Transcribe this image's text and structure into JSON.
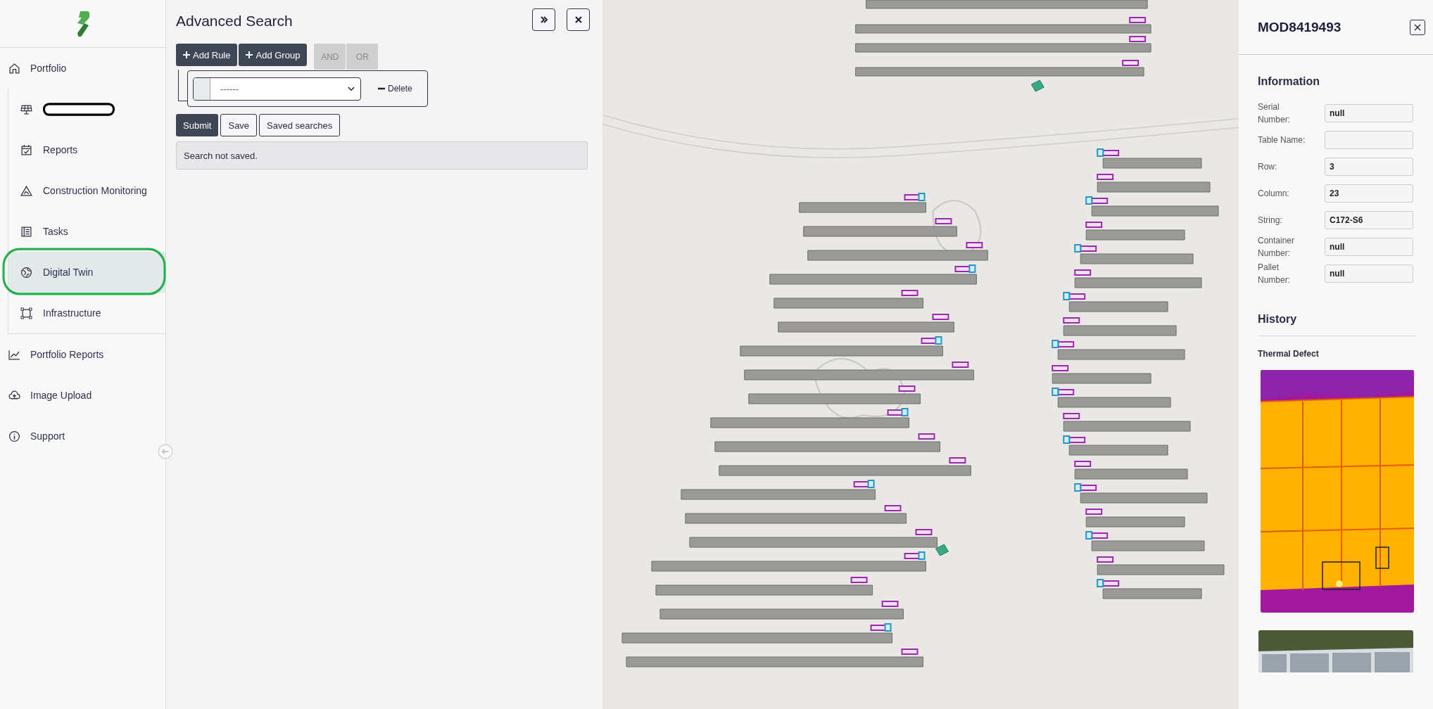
{
  "sidebar": {
    "items": [
      {
        "label": "Portfolio",
        "selected": false,
        "children": [
          {
            "kind": "redacted",
            "selected": false,
            "highlighted": false
          },
          {
            "kind": "link",
            "label": "Reports",
            "selected": false,
            "highlighted": false
          },
          {
            "kind": "link",
            "label": "Construction Monitoring",
            "selected": false,
            "highlighted": false
          },
          {
            "kind": "link",
            "label": "Tasks",
            "selected": false,
            "highlighted": false
          },
          {
            "kind": "link",
            "label": "Digital Twin",
            "selected": true,
            "highlighted": true
          },
          {
            "kind": "link",
            "label": "Infrastructure",
            "selected": false,
            "highlighted": false
          }
        ]
      },
      {
        "label": "Portfolio Reports",
        "selected": false
      },
      {
        "label": "Image Upload",
        "selected": false
      },
      {
        "label": "Support",
        "selected": false
      }
    ]
  },
  "advanced_search": {
    "title": "Advanced Search",
    "add_buttons": [
      "Add Rule",
      "Add Group"
    ],
    "combinators": [
      {
        "label": "AND",
        "disabled": true
      },
      {
        "label": "OR",
        "disabled": true
      }
    ],
    "rule": {
      "value": "------",
      "delete": "Delete"
    },
    "actions": [
      {
        "label": "Submit",
        "kind": "primary"
      },
      {
        "label": "Save",
        "kind": "secondary"
      },
      {
        "label": "Saved searches",
        "kind": "secondary"
      }
    ],
    "status": "Search not saved."
  },
  "detail_panel": {
    "title": "MOD8419493",
    "section_title": "Information",
    "fields": [
      {
        "label": "Serial Number:",
        "value": "null"
      },
      {
        "label": "Table Name:"
      },
      {
        "label": "Row:",
        "value": "3"
      },
      {
        "label": "Column:",
        "value": "23"
      },
      {
        "label": "String:",
        "value": "C172-S6"
      },
      {
        "label": "Container Number:",
        "value": "null"
      },
      {
        "label": "Pallet Number:",
        "value": "null"
      }
    ],
    "history_title": "History",
    "history": [
      {
        "title": "Thermal Defect"
      }
    ]
  }
}
